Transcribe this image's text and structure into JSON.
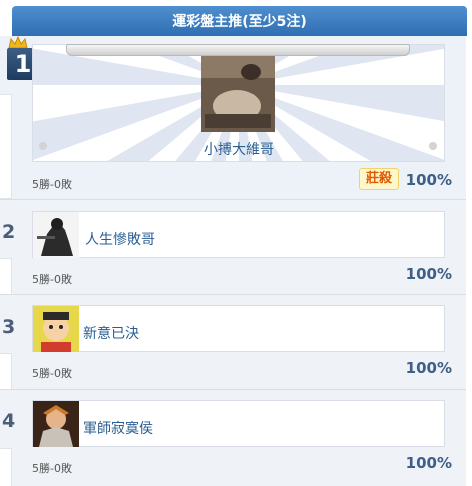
{
  "header": {
    "title": "運彩盤主推(至少5注)"
  },
  "entries": [
    {
      "rank": "1",
      "name": "小搏大維哥",
      "record": "5勝-0敗",
      "percent": "100%",
      "badge": "莊殺"
    },
    {
      "rank": "2",
      "name": "人生慘敗哥",
      "record": "5勝-0敗",
      "percent": "100%"
    },
    {
      "rank": "3",
      "name": "新意已決",
      "record": "5勝-0敗",
      "percent": "100%"
    },
    {
      "rank": "4",
      "name": "軍師寂寞侯",
      "record": "5勝-0敗",
      "percent": "100%"
    }
  ],
  "colors": {
    "header": "#3a7bc0",
    "row_bg": "#eff2f7",
    "name": "#2a5e93",
    "percent": "#3f5f86",
    "badge": "#e05a00"
  },
  "icons": [
    "crown-icon"
  ]
}
